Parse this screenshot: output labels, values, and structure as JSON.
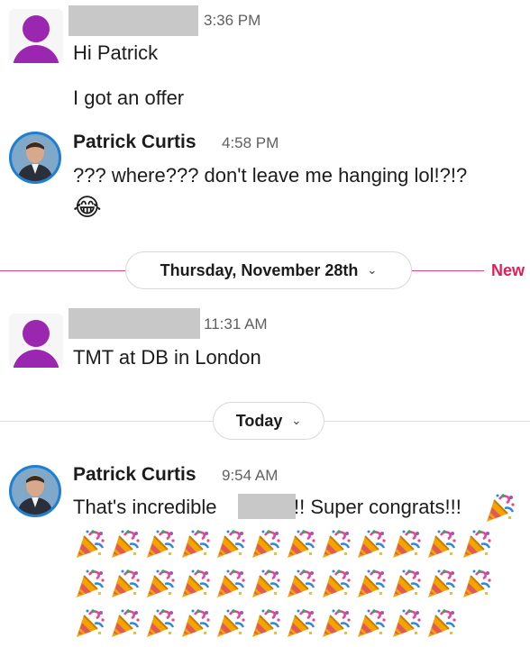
{
  "messages": [
    {
      "time": "3:36 PM",
      "lines": [
        "Hi Patrick",
        "I got an offer"
      ]
    },
    {
      "sender": "Patrick Curtis",
      "time": "4:58 PM",
      "text": "???  where???  don't leave me hanging lol!?!?",
      "emoji": "😂"
    },
    {
      "time": "11:31 AM",
      "text": "TMT at DB in London"
    },
    {
      "sender": "Patrick Curtis",
      "time": "9:54 AM",
      "text_before": "That's incredible",
      "text_after": "!! Super congrats!!!",
      "party_count": 36
    }
  ],
  "dividers": {
    "date1": "Thursday, November 28th",
    "new_label": "New",
    "date2": "Today"
  },
  "icons": {
    "chevron": "chevron-down-icon",
    "party": "party-popper-icon"
  },
  "colors": {
    "new_accent": "#e01e5a",
    "avatar_purple": "#9b27b0"
  }
}
